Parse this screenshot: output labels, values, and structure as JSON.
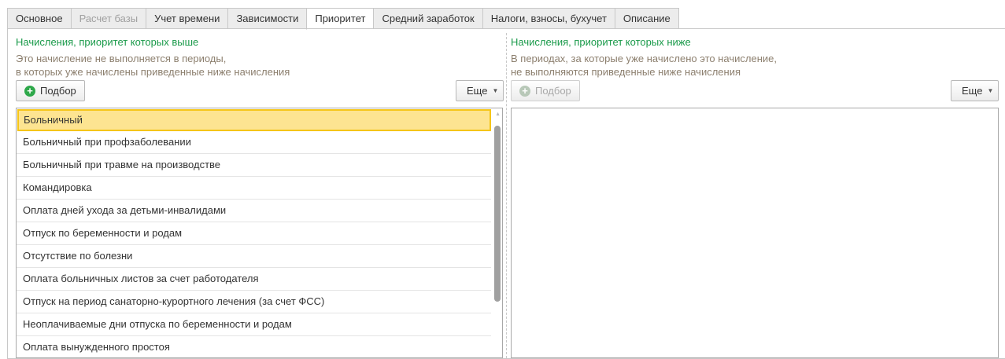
{
  "tabs": [
    {
      "label": "Основное",
      "state": "normal"
    },
    {
      "label": "Расчет базы",
      "state": "disabled"
    },
    {
      "label": "Учет времени",
      "state": "normal"
    },
    {
      "label": "Зависимости",
      "state": "normal"
    },
    {
      "label": "Приоритет",
      "state": "active"
    },
    {
      "label": "Средний заработок",
      "state": "normal"
    },
    {
      "label": "Налоги, взносы, бухучет",
      "state": "normal"
    },
    {
      "label": "Описание",
      "state": "normal"
    }
  ],
  "left": {
    "title": "Начисления, приоритет которых выше",
    "desc1": "Это начисление не выполняется в периоды,",
    "desc2": "в которых уже начислены приведенные ниже начисления",
    "pick": "Подбор",
    "more": "Еще",
    "items": [
      "Больничный",
      "Больничный при профзаболевании",
      "Больничный при травме на производстве",
      "Командировка",
      "Оплата дней ухода за детьми-инвалидами",
      "Отпуск по беременности и родам",
      "Отсутствие по болезни",
      "Оплата больничных листов за счет работодателя",
      "Отпуск на период санаторно-курортного лечения (за счет ФСС)",
      "Неоплачиваемые дни отпуска по беременности и родам",
      "Оплата вынужденного простоя"
    ]
  },
  "right": {
    "title": "Начисления, приоритет которых ниже",
    "desc1": "В периодах, за которые уже начислено это начисление,",
    "desc2": "не выполняются приведенные ниже начисления",
    "pick": "Подбор",
    "more": "Еще"
  }
}
